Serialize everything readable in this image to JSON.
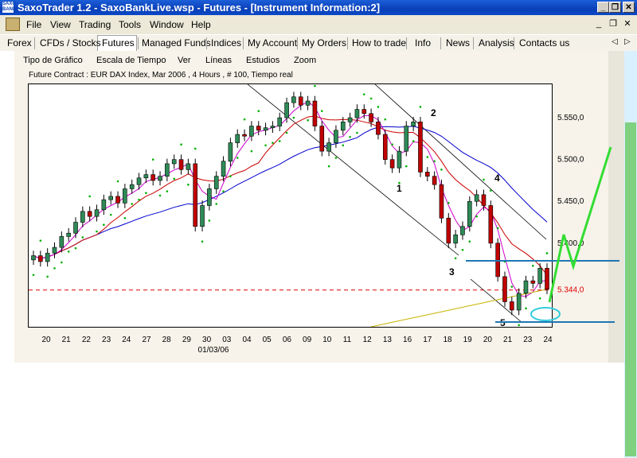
{
  "window": {
    "title": "SaxoTrader 1.2 - SaxoBankLive.wsp - Futures - [Instrument Information:2]",
    "app_icon_text": "SAXO BANK",
    "minimize": "_",
    "restore": "❐",
    "close": "✕"
  },
  "menu": {
    "items": [
      "File",
      "View",
      "Trading",
      "Tools",
      "Window",
      "Help"
    ],
    "mdi_minimize": "_",
    "mdi_restore": "❐",
    "mdi_close": "✕"
  },
  "tabs": {
    "items": [
      "Forex",
      "CFDs / Stocks",
      "Futures",
      "Managed Funds",
      "Indices",
      "My Account",
      "My Orders",
      "How to trade",
      "Info",
      "News",
      "Analysis",
      "Contacts us"
    ],
    "active": "Futures",
    "prev": "◁",
    "next": "▷"
  },
  "chart_toolbar": {
    "items": [
      "Tipo de Gráfico",
      "Escala de Tiempo",
      "Ver",
      "Líneas",
      "Estudios",
      "Zoom"
    ]
  },
  "chart_header": "Future Contract : EUR DAX Index, Mar 2006 , 4 Hours , # 100, Tiempo real",
  "colors": {
    "price_candles": "#000000",
    "up_candle": "#2e8b57",
    "down_candle": "#c00000",
    "ma_short": "#cc00cc",
    "ma_medium": "#cc0000",
    "ma_long": "#0000cc",
    "ma_200": "#c8b400",
    "parabolic_sar": "#00b000",
    "support_lines": "#1f77b4",
    "price_line": "#dd0000",
    "projection": "#33dd33",
    "ellipse": "#33ccdd"
  },
  "chart_data": {
    "type": "candlestick",
    "title": "Future Contract : EUR DAX Index, Mar 2006 , 4 Hours , # 100, Tiempo real",
    "x_tick_labels": [
      "20",
      "21",
      "22",
      "23",
      "24",
      "27",
      "28",
      "29",
      "30",
      "03",
      "04",
      "05",
      "06",
      "09",
      "10",
      "11",
      "12",
      "13",
      "16",
      "17",
      "18",
      "19",
      "20",
      "21",
      "23",
      "24"
    ],
    "x_sublabel": "01/03/06",
    "y_tick_labels": [
      "5.550,0",
      "5.500,0",
      "5.450,0",
      "5.400,0",
      "5.344,0"
    ],
    "current_price": 5344.0,
    "ylim": [
      5300,
      5590
    ],
    "wave_labels": [
      "1",
      "2",
      "3",
      "4",
      "5"
    ],
    "closes": [
      5385,
      5378,
      5388,
      5395,
      5408,
      5412,
      5425,
      5438,
      5432,
      5440,
      5452,
      5456,
      5448,
      5465,
      5470,
      5478,
      5482,
      5475,
      5480,
      5495,
      5500,
      5488,
      5495,
      5420,
      5445,
      5465,
      5480,
      5498,
      5520,
      5530,
      5528,
      5540,
      5535,
      5538,
      5540,
      5550,
      5568,
      5575,
      5565,
      5570,
      5540,
      5510,
      5520,
      5535,
      5545,
      5550,
      5560,
      5555,
      5545,
      5530,
      5500,
      5490,
      5510,
      5540,
      5545,
      5485,
      5480,
      5470,
      5430,
      5400,
      5410,
      5420,
      5450,
      5458,
      5445,
      5400,
      5360,
      5330,
      5320,
      5340,
      5355,
      5352,
      5370,
      5345
    ]
  }
}
